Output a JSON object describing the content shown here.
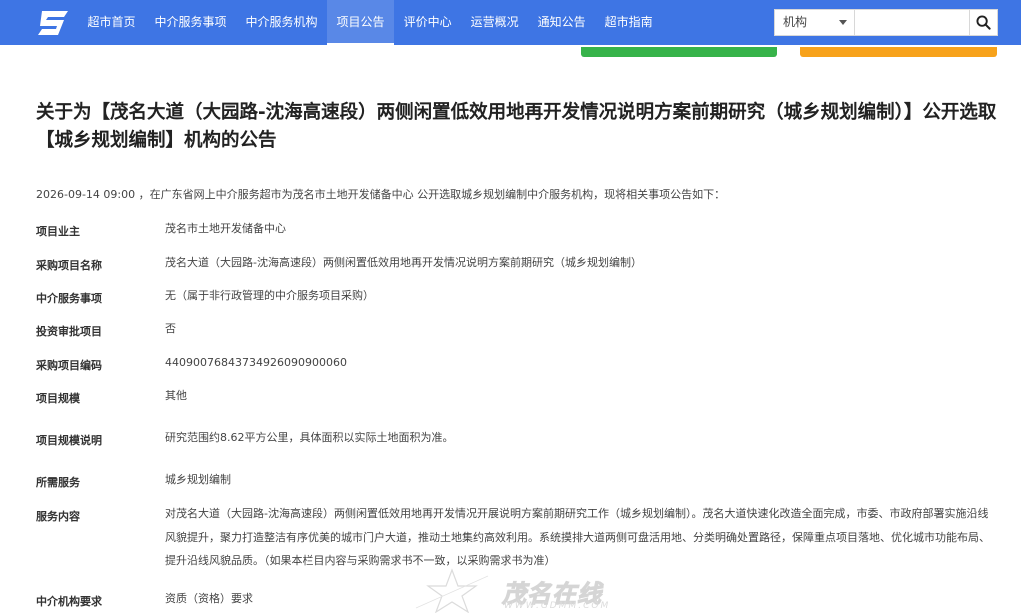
{
  "nav": {
    "items": [
      "超市首页",
      "中介服务事项",
      "中介服务机构",
      "项目公告",
      "评价中心",
      "运营概况",
      "通知公告",
      "超市指南"
    ],
    "active_index": 3
  },
  "search": {
    "select_value": "机构",
    "placeholder": ""
  },
  "colors": {
    "header": "#3e75e4",
    "green_button": "#37b34a",
    "orange_button": "#f7a21b"
  },
  "notice": {
    "title": "关于为【茂名大道（大园路-沈海高速段）两侧闲置低效用地再开发情况说明方案前期研究（城乡规划编制）】公开选取【城乡规划编制】机构的公告",
    "intro": "2026-09-14 09:00 ，在广东省网上中介服务超市为茂名市土地开发储备中心 公开选取城乡规划编制中介服务机构，现将相关事项公告如下：",
    "rows": [
      {
        "label": "项目业主",
        "value": "茂名市土地开发储备中心"
      },
      {
        "label": "采购项目名称",
        "value": "茂名大道（大园路-沈海高速段）两侧闲置低效用地再开发情况说明方案前期研究（城乡规划编制）"
      },
      {
        "label": "中介服务事项",
        "value": "无（属于非行政管理的中介服务项目采购）"
      },
      {
        "label": "投资审批项目",
        "value": "否"
      },
      {
        "label": "采购项目编码",
        "value": "44090076843734926090900060"
      },
      {
        "label": "项目规模",
        "value": "其他"
      },
      {
        "label": "项目规模说明",
        "value": "研究范围约8.62平方公里，具体面积以实际土地面积为准。"
      },
      {
        "label": "所需服务",
        "value": "城乡规划编制"
      },
      {
        "label": "服务内容",
        "value": "对茂名大道（大园路-沈海高速段）两侧闲置低效用地再开发情况开展说明方案前期研究工作（城乡规划编制）。茂名大道快速化改造全面完成，市委、市政府部署实施沿线风貌提升，聚力打造整洁有序优美的城市门户大道，推动土地集约高效利用。系统摸排大道两侧可盘活用地、分类明确处置路径，保障重点项目落地、优化城市功能布局、提升沿线风貌品质。（如果本栏目内容与采购需求书不一致，以采购需求书为准）"
      },
      {
        "label": "中介机构要求",
        "value": "资质（资格）要求"
      }
    ]
  },
  "watermark": {
    "text": "茂名在线",
    "url": "WWW.GDMM.COM"
  }
}
